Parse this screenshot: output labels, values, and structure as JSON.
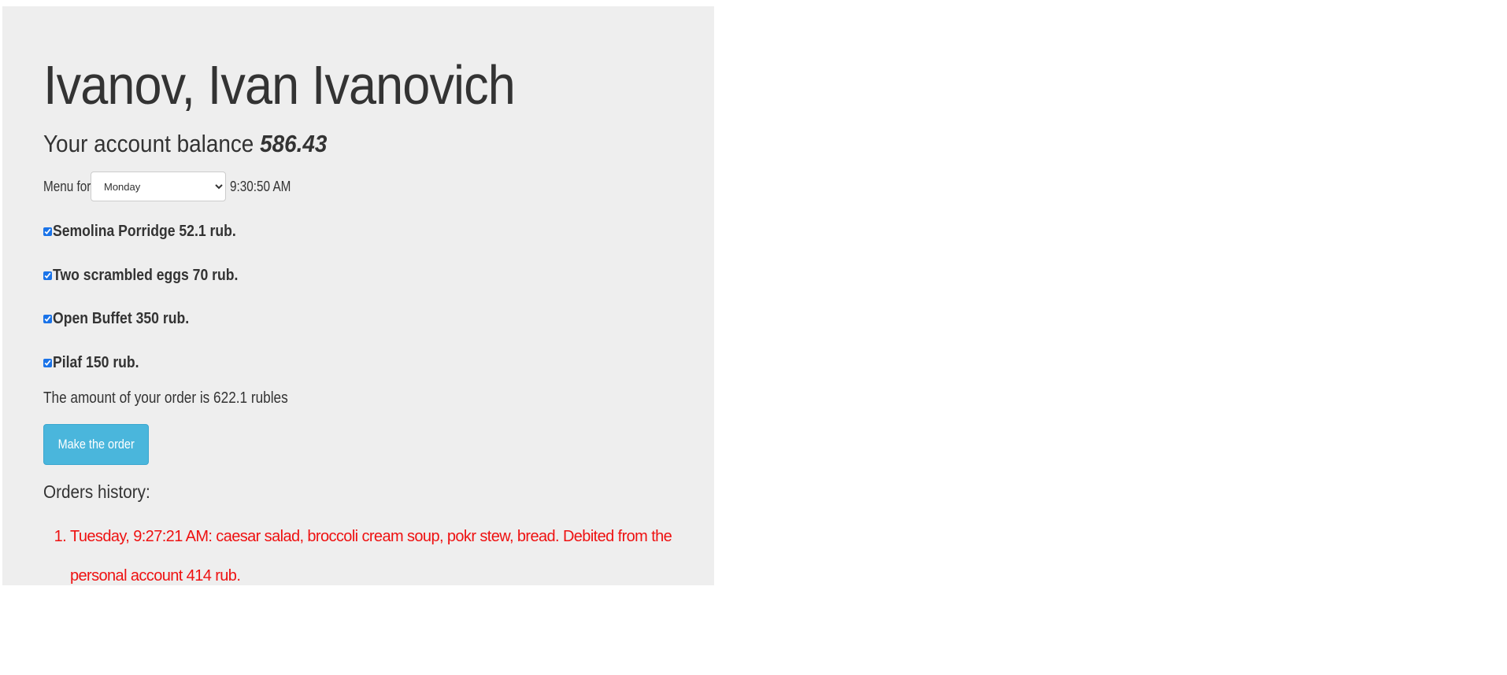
{
  "user": {
    "name": "Ivanov, Ivan Ivanovich",
    "balance_label": "Your account balance",
    "balance_value": "586.43"
  },
  "menu": {
    "label": "Menu for",
    "selected_day": "Monday",
    "days": [
      "Monday"
    ],
    "time": "9:30:50 AM"
  },
  "dishes": [
    {
      "label": "Semolina Porridge 52.1 rub.",
      "checked": true
    },
    {
      "label": "Two scrambled eggs 70 rub.",
      "checked": true
    },
    {
      "label": "Open Buffet 350 rub.",
      "checked": true
    },
    {
      "label": "Pilaf 150 rub.",
      "checked": true
    }
  ],
  "order": {
    "total_text": "The amount of your order is 622.1 rubles",
    "button_label": "Make the order"
  },
  "history": {
    "title": "Orders history:",
    "items": [
      "Tuesday, 9:27:21 AM: caesar salad, broccoli cream soup, pokr stew, bread. Debited from the personal account 414 rub."
    ]
  },
  "colors": {
    "panel_bg": "#eeeeee",
    "button_bg": "#4ab6dc",
    "history_text": "#ee1111"
  }
}
